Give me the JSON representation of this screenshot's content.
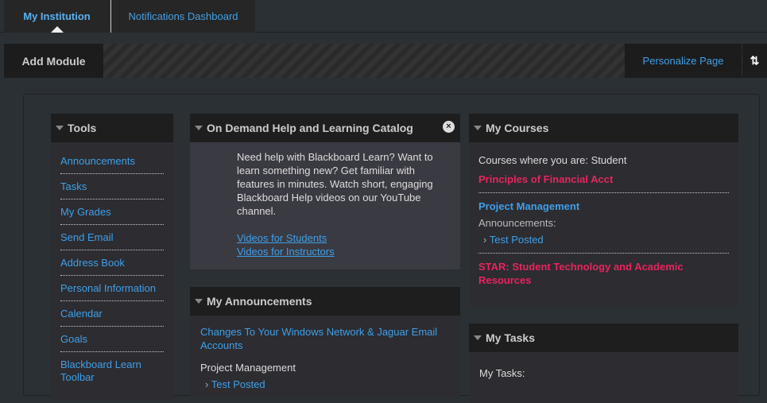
{
  "tabs": [
    {
      "label": "My Institution"
    },
    {
      "label": "Notifications Dashboard"
    }
  ],
  "toolbar": {
    "add_module": "Add Module",
    "personalize": "Personalize Page",
    "reorder_icon": "⇅"
  },
  "tools": {
    "title": "Tools",
    "items": [
      "Announcements",
      "Tasks",
      "My Grades",
      "Send Email",
      "Address Book",
      "Personal Information",
      "Calendar",
      "Goals",
      "Blackboard Learn Toolbar"
    ]
  },
  "help": {
    "title": "On Demand Help and Learning Catalog",
    "text": "Need help with Blackboard Learn? Want to learn something new? Get familiar with features in minutes. Watch short, engaging Blackboard Help videos on our YouTube channel.",
    "link_students": "Videos for Students",
    "link_instructors": "Videos for Instructors"
  },
  "announcements": {
    "title": "My Announcements",
    "item": "Changes To Your Windows Network & Jaguar Email Accounts",
    "course": "Project Management",
    "sub": "Test Posted"
  },
  "courses": {
    "title": "My Courses",
    "intro": "Courses where you are: Student",
    "c1": "Principles of Financial Acct",
    "c2": "Project Management",
    "ann_label": "Announcements:",
    "ann_item": "Test Posted",
    "c3": "STAR: Student Technology and Academic Resources"
  },
  "tasks": {
    "title": "My Tasks",
    "label": "My Tasks:"
  }
}
